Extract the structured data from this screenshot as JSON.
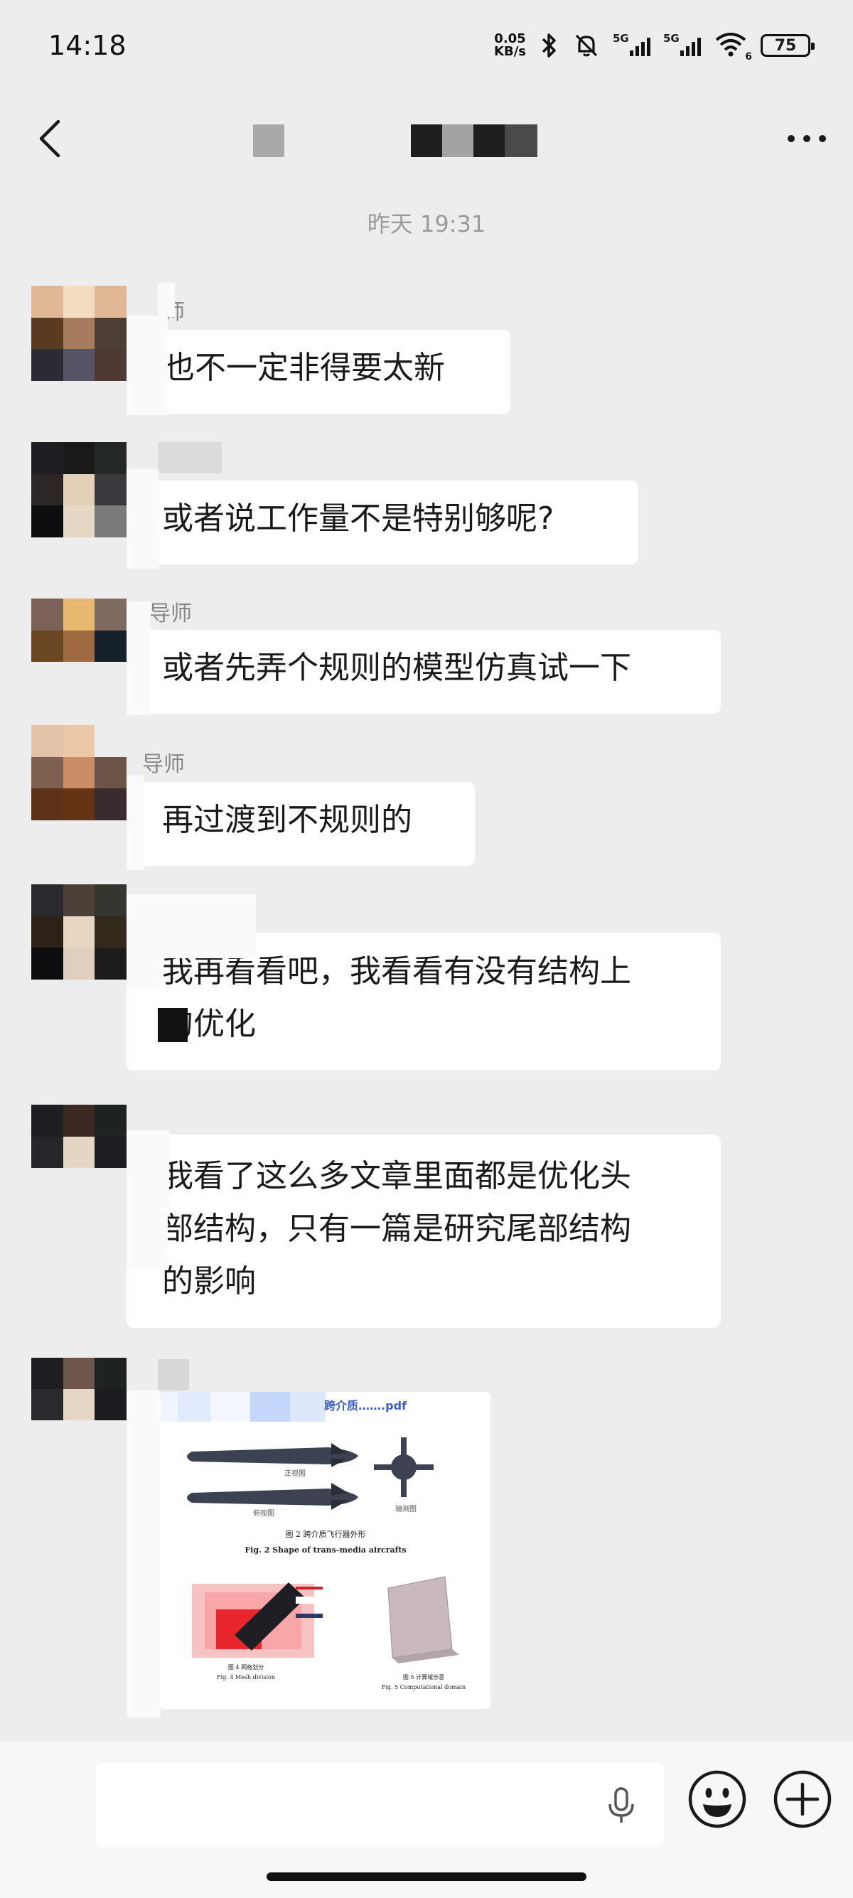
{
  "status_bar": {
    "time": "14:18",
    "net_speed_value": "0.05",
    "net_speed_unit": "KB/s",
    "signal1_label": "5G",
    "signal2_label": "5G",
    "wifi_sub": "6",
    "battery": "75"
  },
  "header": {
    "back_icon": "chevron-left-icon",
    "more_icon": "more-dots-icon"
  },
  "chat": {
    "timestamp": "昨天 19:31",
    "messages": [
      {
        "sender": "师",
        "text": "也不一定非得要太新"
      },
      {
        "sender": "",
        "text": "或者说工作量不是特别够呢?"
      },
      {
        "sender": "导师",
        "text": "或者先弄个规则的模型仿真试一下"
      },
      {
        "sender": "导师",
        "text": "再过渡到不规则的"
      },
      {
        "sender": "",
        "line1": "我再看看吧，我看看有没有结构上",
        "line2": "的优化"
      },
      {
        "sender": "",
        "line1": "我看了这么多文章里面都是优化头",
        "line2": "部结构，只有一篇是研究尾部结构",
        "line3": "的影响"
      }
    ],
    "file": {
      "name": "跨介质…….pdf",
      "label_side": "正视图",
      "label_bottom": "俯视图",
      "label_iso": "轴测图",
      "caption_cn": "图 2   跨介质飞行器外形",
      "caption_en": "Fig. 2   Shape of trans-media aircrafts",
      "sub1_cn": "图 4   网格划分",
      "sub1_en": "Fig. 4   Mesh division",
      "sub2_cn": "图 5   计算域示意",
      "sub2_en": "Fig. 5   Computational domain"
    }
  },
  "input_bar": {
    "voice_icon": "microphone-icon",
    "emoji_icon": "emoji-icon",
    "plus_icon": "plus-circle-icon"
  }
}
